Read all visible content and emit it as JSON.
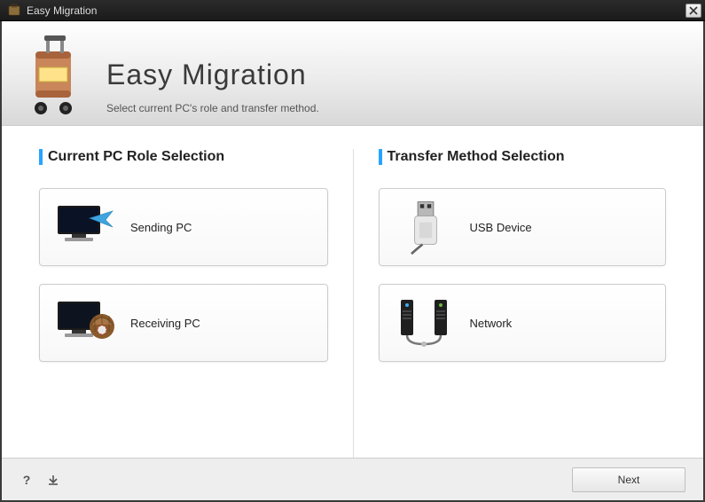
{
  "titlebar": {
    "title": "Easy Migration"
  },
  "header": {
    "app_title": "Easy Migration",
    "subtitle": "Select current PC's role and transfer method."
  },
  "role_section": {
    "heading": "Current PC Role Selection",
    "options": [
      {
        "label": "Sending PC"
      },
      {
        "label": "Receiving PC"
      }
    ]
  },
  "method_section": {
    "heading": "Transfer Method Selection",
    "options": [
      {
        "label": "USB Device"
      },
      {
        "label": "Network"
      }
    ]
  },
  "footer": {
    "next_label": "Next"
  },
  "colors": {
    "accent": "#29a3ff"
  }
}
